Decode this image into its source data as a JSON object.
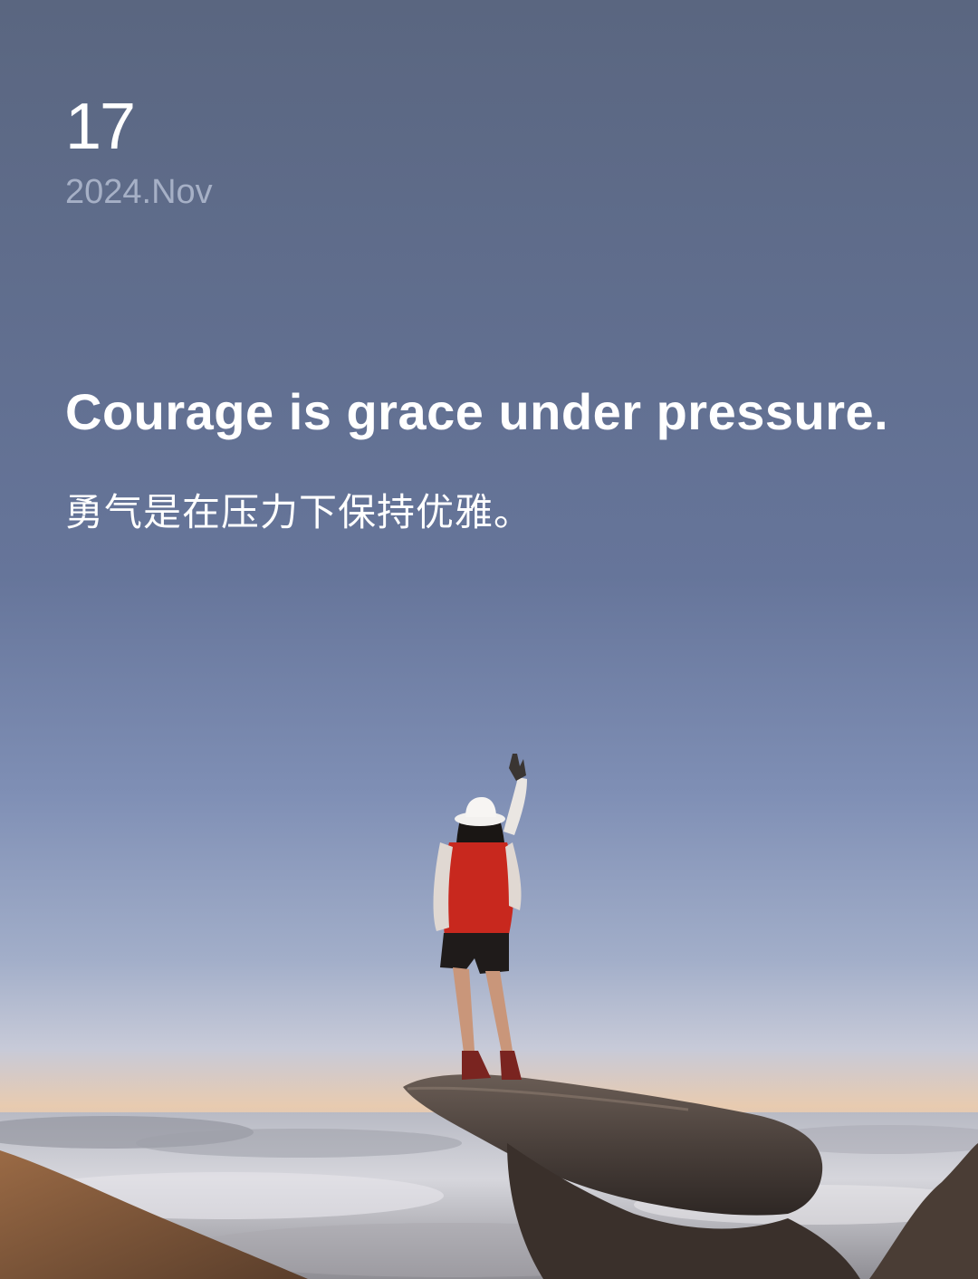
{
  "card": {
    "day": "17",
    "month_year": "2024.Nov",
    "quote_en": "Courage is grace under pressure.",
    "quote_zh": "勇气是在压力下保持优雅。"
  },
  "colors": {
    "sky_top": "#5a6680",
    "sky_mid": "#7a89ad",
    "horizon_glow": "#e8cbb0",
    "text_primary": "#ffffff",
    "text_secondary": "#a6b0c6"
  }
}
